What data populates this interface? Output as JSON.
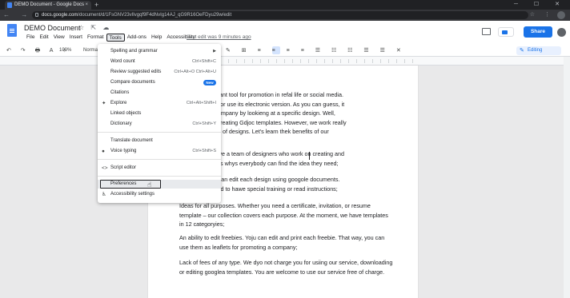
{
  "browser": {
    "tab_title": "DEMO Document - Google Docs",
    "tab_close": "×",
    "new_tab": "+",
    "window_controls": "─ ☐ ✕",
    "nav_buttons": "← → ⟳",
    "url_host": "docs.google.com",
    "url_path": "/document/d/1FsGNV23vlIvgqf9F4dNvIg14AJ_qG9R16OeFDyu29w/edit",
    "right_icons": "☆ ⋮"
  },
  "doc": {
    "title": "DEMO Document",
    "title_icons": "☆ ⇱ ☁",
    "menus": [
      "File",
      "Edit",
      "View",
      "Insert",
      "Format",
      "Tools",
      "Add-ons",
      "Help",
      "Accessibility"
    ],
    "last_edit": "Last edit was 9 minutes ago",
    "share_label": "Share"
  },
  "toolbar": {
    "left_icons": "↶ ↷ 🖶 A ⌖",
    "zoom": "100%",
    "style": "Normal",
    "right_icons": "✎ ⊞ ≡ ≡ ≡ ≡ ☰ ☷ ☷ ☰ ☰ ✕",
    "mode": "Editing"
  },
  "tools_menu": {
    "items": [
      {
        "label": "Spelling and grammar",
        "shortcut": "",
        "icon": "",
        "has_submenu": true
      },
      {
        "label": "Word count",
        "shortcut": "Ctrl+Shift+C",
        "icon": ""
      },
      {
        "label": "Review suggested edits",
        "shortcut": "Ctrl+Alt+O Ctrl+Alt+U",
        "icon": ""
      },
      {
        "label": "Compare documents",
        "shortcut": "",
        "badge": "New",
        "icon": ""
      },
      {
        "label": "Citations",
        "shortcut": "",
        "icon": ""
      },
      {
        "label": "Explore",
        "shortcut": "Ctrl+Alt+Shift+I",
        "icon": "✦"
      },
      {
        "label": "Linked objects",
        "shortcut": "",
        "icon": ""
      },
      {
        "label": "Dictionary",
        "shortcut": "Ctrl+Shift+Y",
        "icon": ""
      },
      {
        "label": "Translate document",
        "shortcut": "",
        "icon": ""
      },
      {
        "label": "Voice typing",
        "shortcut": "Ctrl+Shift+S",
        "icon": "🎤"
      },
      {
        "label": "Script editor",
        "shortcut": "",
        "icon": "<>"
      },
      {
        "label": "Preferences",
        "shortcut": "",
        "icon": ""
      },
      {
        "label": "Accessibility settings",
        "shortcut": "",
        "icon": "♿"
      }
    ]
  },
  "content": {
    "p1": [
      "ts are an important tool for promotion in refal life or social media.",
      "rint a templsate or use its electronic version. As you can guess, it",
      "member your company by lookieng at a specific design. Well,",
      "ot a pioneer in creating Gdjoc templates. However, we work really",
      "e highest quality of designs. Let's learn thek benefits of our"
    ],
    "p2": [
      "position. We have a team of designers who work on creating and",
      "mplatese. That is whys everybody can find the idea they need;"
    ],
    "p3": [
      "ailleability. You can edit each design using googole documents.",
      "t you do not need to hawe special training or read instructions;"
    ],
    "p4": [
      "Ideas for all purposes. Whether you need a certificate, invitation, or resume",
      "template – our collection covers each purpose. At the moment, we have templates",
      "in 12 categoryies;"
    ],
    "p5": [
      "An ability to edit freebies. Yoju can edit and print each freebie. That way, you can",
      "use them as leaflets for promoting a company;"
    ],
    "p6": [
      "Lack of fees of any type. We dyo not charge you for usiing our service, downloading",
      "or editing googlea templates. You are welcome to use our service free of charge."
    ]
  }
}
